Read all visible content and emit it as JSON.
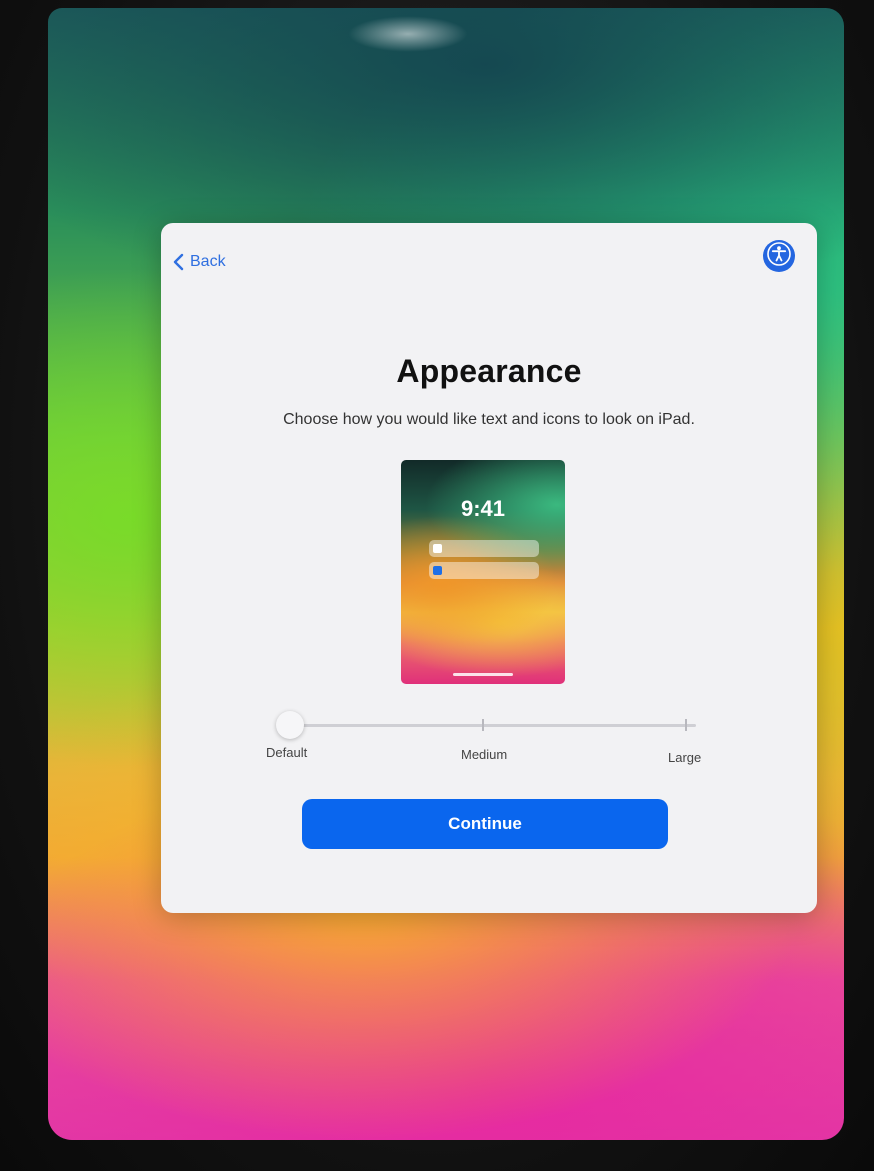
{
  "nav": {
    "back_label": "Back",
    "accessibility_icon": "accessibility-icon"
  },
  "main": {
    "title": "Appearance",
    "subtitle": "Choose how you would like text and icons to look on iPad."
  },
  "preview": {
    "time": "9:41"
  },
  "text_size": {
    "options": [
      "Default",
      "Medium",
      "Large"
    ],
    "selected": "Default",
    "selected_index": 0
  },
  "actions": {
    "continue_label": "Continue"
  },
  "colors": {
    "accent": "#0a66ee",
    "link": "#2f6fe0",
    "sheet_background": "#f2f2f4"
  }
}
